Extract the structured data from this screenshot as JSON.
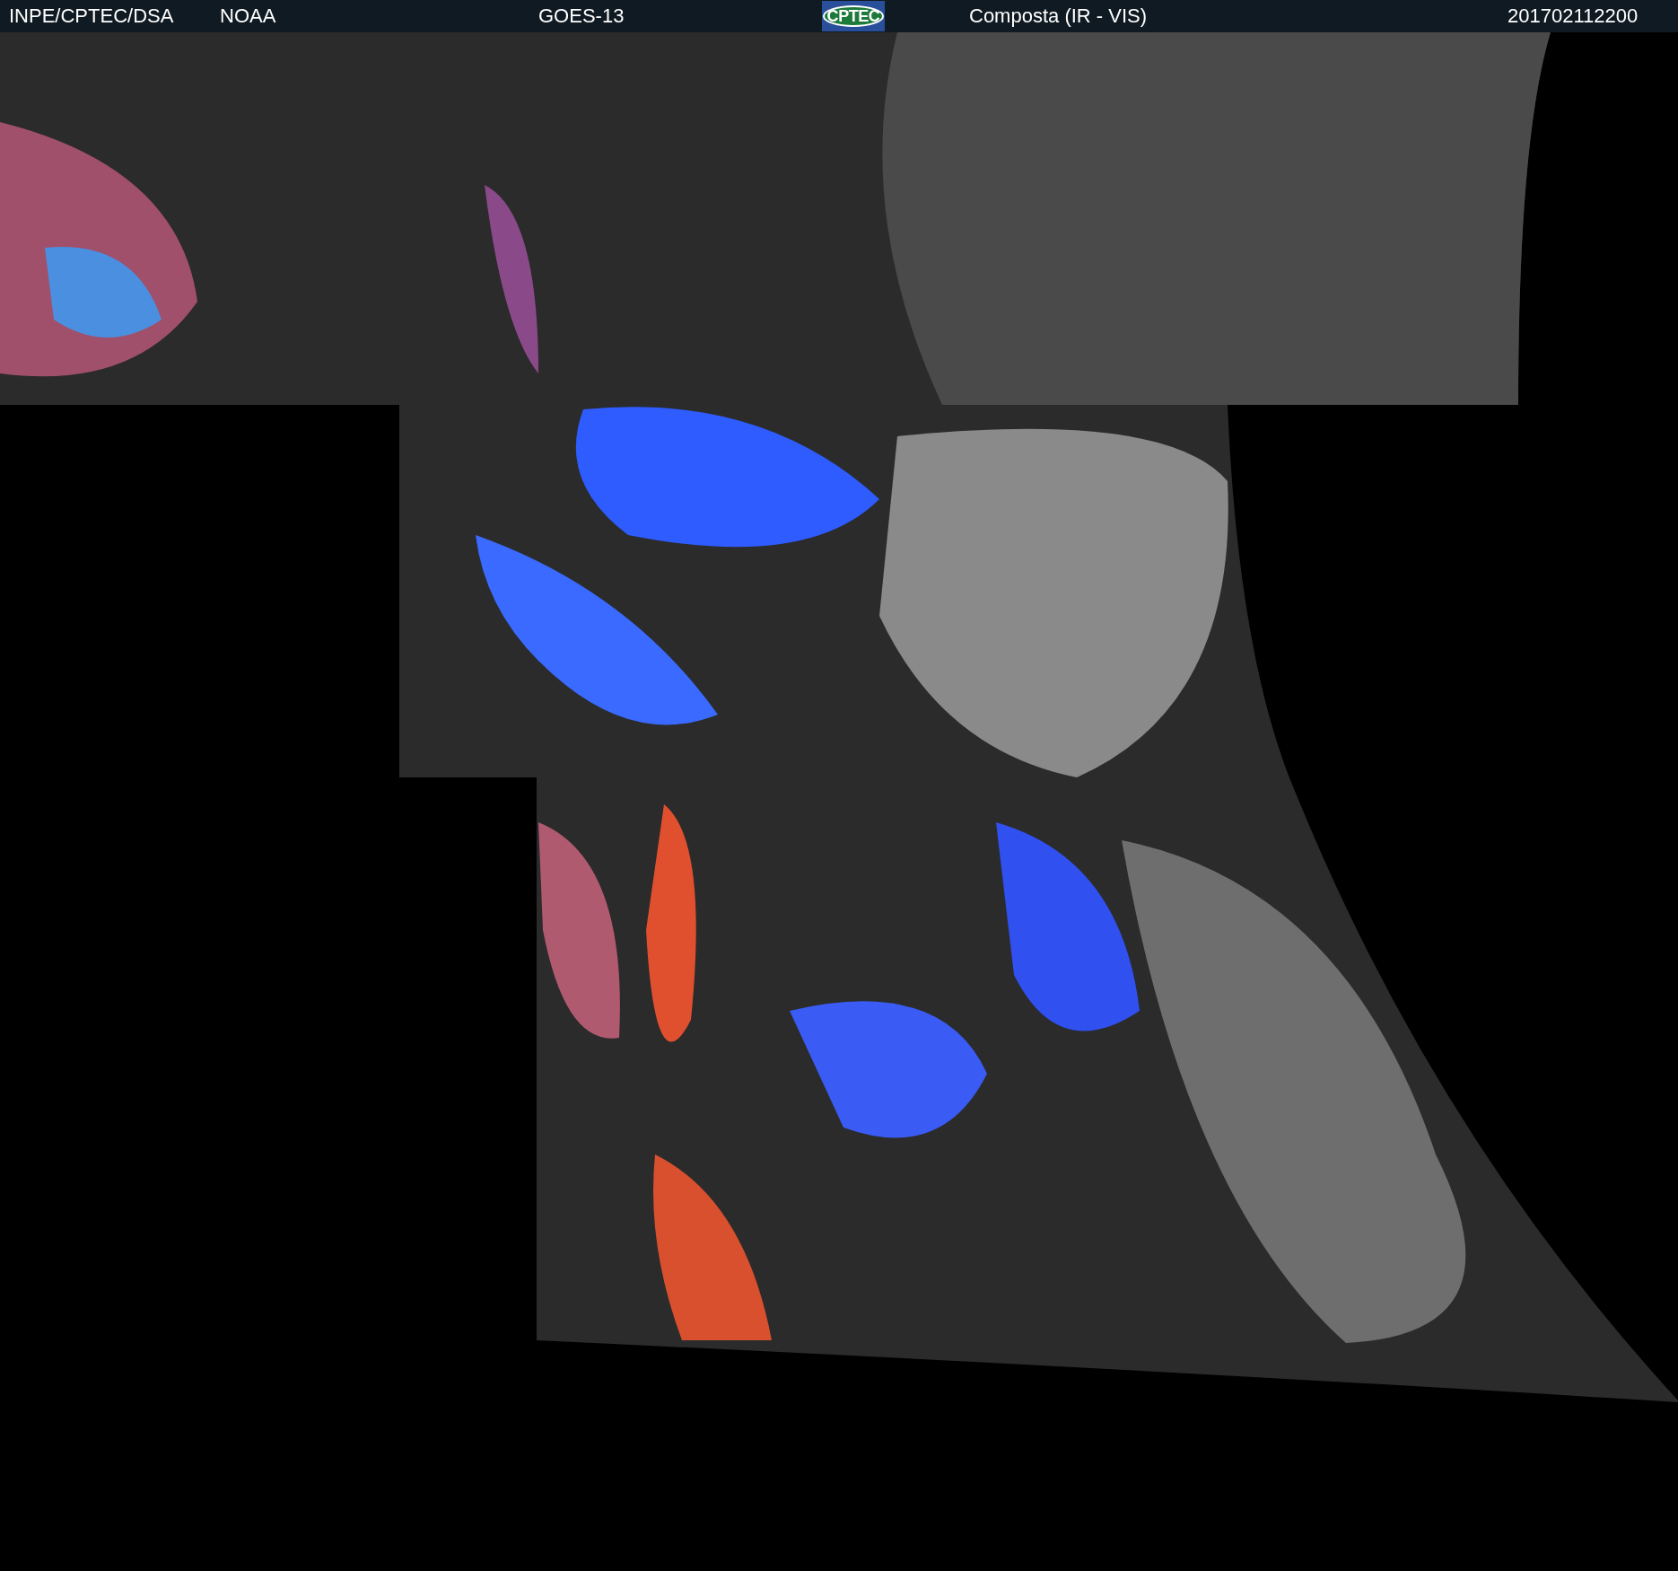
{
  "header": {
    "source": "INPE/CPTEC/DSA",
    "agency": "NOAA",
    "satellite": "GOES-13",
    "logo": "CPTEC",
    "product": "Composta (IR - VIS)",
    "timestamp": "201702112200"
  }
}
